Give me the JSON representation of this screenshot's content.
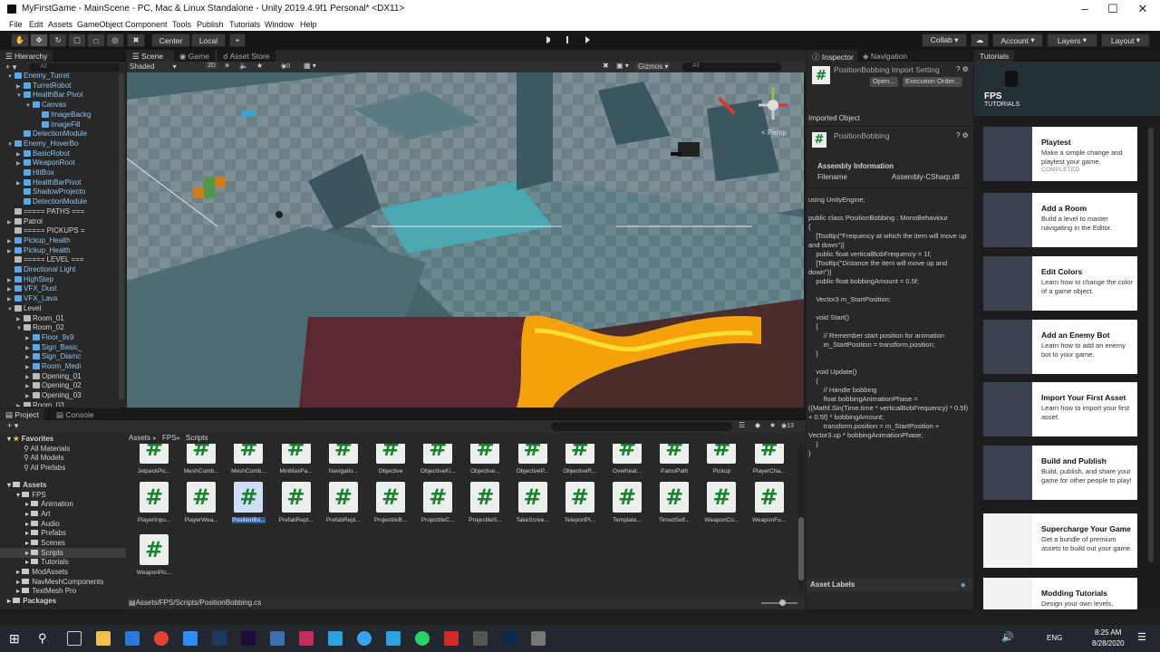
{
  "window": {
    "title": "MyFirstGame - MainScene - PC, Mac & Linux Standalone - Unity 2019.4.9f1 Personal* <DX11>"
  },
  "menu": [
    "File",
    "Edit",
    "Assets",
    "GameObject",
    "Component",
    "Tools",
    "Publish",
    "Tutorials",
    "Window",
    "Help"
  ],
  "toolbar": {
    "center": "Center",
    "local": "Local",
    "collab": "Collab ▾",
    "account": "Account",
    "layers": "Layers",
    "layout": "Layout"
  },
  "hierarchy": {
    "tab": "Hierarchy",
    "search_placeholder": "All",
    "items": [
      {
        "label": "Enemy_Turret",
        "indent": 0,
        "arrow": "▼",
        "icon": "blue"
      },
      {
        "label": "TurretRobot",
        "indent": 1,
        "arrow": "▶",
        "icon": "blue"
      },
      {
        "label": "HealthBar Pivot",
        "indent": 1,
        "arrow": "▼",
        "icon": "blue"
      },
      {
        "label": "Canvas",
        "indent": 2,
        "arrow": "▼",
        "icon": "blue"
      },
      {
        "label": "ImageBackg",
        "indent": 3,
        "arrow": "",
        "icon": "blue"
      },
      {
        "label": "ImageFill",
        "indent": 3,
        "arrow": "",
        "icon": "blue"
      },
      {
        "label": "DetectionModule",
        "indent": 1,
        "arrow": "",
        "icon": "blue"
      },
      {
        "label": "Enemy_HoverBo",
        "indent": 0,
        "arrow": "▼",
        "icon": "blue"
      },
      {
        "label": "BasicRobot",
        "indent": 1,
        "arrow": "▶",
        "icon": "blue"
      },
      {
        "label": "WeaponRoot",
        "indent": 1,
        "arrow": "▶",
        "icon": "blue"
      },
      {
        "label": "HitBox",
        "indent": 1,
        "arrow": "",
        "icon": "blue"
      },
      {
        "label": "HealthBarPivot",
        "indent": 1,
        "arrow": "▶",
        "icon": "blue"
      },
      {
        "label": "ShadowProjecto",
        "indent": 1,
        "arrow": "",
        "icon": "blue"
      },
      {
        "label": "DetectionModule",
        "indent": 1,
        "arrow": "",
        "icon": "blue"
      },
      {
        "label": "===== PATHS ===",
        "indent": 0,
        "arrow": "",
        "icon": "gray"
      },
      {
        "label": "Patrol",
        "indent": 0,
        "arrow": "▶",
        "icon": "gray"
      },
      {
        "label": "===== PICKUPS =",
        "indent": 0,
        "arrow": "",
        "icon": "gray"
      },
      {
        "label": "Pickup_Health",
        "indent": 0,
        "arrow": "▶",
        "icon": "blue"
      },
      {
        "label": "Pickup_Health",
        "indent": 0,
        "arrow": "▶",
        "icon": "blue"
      },
      {
        "label": "===== LEVEL ===",
        "indent": 0,
        "arrow": "",
        "icon": "gray"
      },
      {
        "label": "Directional Light",
        "indent": 0,
        "arrow": "",
        "icon": "blue"
      },
      {
        "label": "HighStep",
        "indent": 0,
        "arrow": "▶",
        "icon": "blue"
      },
      {
        "label": "VFX_Dust",
        "indent": 0,
        "arrow": "▶",
        "icon": "blue"
      },
      {
        "label": "VFX_Lava",
        "indent": 0,
        "arrow": "▶",
        "icon": "blue"
      },
      {
        "label": "Level",
        "indent": 0,
        "arrow": "▼",
        "icon": "gray"
      },
      {
        "label": "Room_01",
        "indent": 1,
        "arrow": "▶",
        "icon": "gray"
      },
      {
        "label": "Room_02",
        "indent": 1,
        "arrow": "▼",
        "icon": "gray"
      },
      {
        "label": "Floor_9x9",
        "indent": 2,
        "arrow": "▶",
        "icon": "blue"
      },
      {
        "label": "Sign_Basic_",
        "indent": 2,
        "arrow": "▶",
        "icon": "blue"
      },
      {
        "label": "Sign_Diamc",
        "indent": 2,
        "arrow": "▶",
        "icon": "blue"
      },
      {
        "label": "Room_Medi",
        "indent": 2,
        "arrow": "▶",
        "icon": "blue"
      },
      {
        "label": "Opening_01",
        "indent": 2,
        "arrow": "▶",
        "icon": "gray"
      },
      {
        "label": "Opening_02",
        "indent": 2,
        "arrow": "▶",
        "icon": "gray"
      },
      {
        "label": "Opening_03",
        "indent": 2,
        "arrow": "▶",
        "icon": "gray"
      },
      {
        "label": "Room_03",
        "indent": 1,
        "arrow": "▶",
        "icon": "gray"
      }
    ]
  },
  "scene": {
    "tabs": [
      "Scene",
      "Game",
      "Asset Store"
    ],
    "shading": "Shaded",
    "mode2d": "2D",
    "fx": "0",
    "gizmos": "Gizmos",
    "search_placeholder": "All",
    "persp": "< Persp"
  },
  "project": {
    "tabs": [
      "Project",
      "Console"
    ],
    "count": "13",
    "breadcrumb": [
      "Assets",
      "FPS",
      "Scripts"
    ],
    "favorites": {
      "label": "Favorites",
      "items": [
        "All Materials",
        "All Models",
        "All Prefabs"
      ]
    },
    "assets_label": "Assets",
    "tree": [
      "FPS",
      "Animation",
      "Art",
      "Audio",
      "Prefabs",
      "Scenes",
      "Scripts",
      "Tutorials",
      "ModAssets",
      "NavMeshComponents",
      "TextMesh Pro"
    ],
    "packages": "Packages",
    "row1": [
      "JetpackPic...",
      "MeshComb...",
      "MeshComb...",
      "MinMaxPa...",
      "Navigatio...",
      "Objective",
      "ObjectiveKi...",
      "Objective...",
      "ObjectiveP...",
      "ObjectiveR...",
      "Overheat...",
      "PatrolPath",
      "Pickup",
      "PlayerCha..."
    ],
    "row2": [
      "PlayerInpu...",
      "PlayerWea...",
      "PositionBo...",
      "PrefabRepl...",
      "PrefabRepl...",
      "ProjectileB...",
      "ProjectileC...",
      "ProjectileS...",
      "TakeScree...",
      "TeleportPl...",
      "Template...",
      "TimedSelf...",
      "WeaponCo...",
      "WeaponFu..."
    ],
    "row3": [
      "WeaponPic..."
    ],
    "status": "Assets/FPS/Scripts/PositionBobbing.cs"
  },
  "inspector": {
    "tabs": [
      "Inspector",
      "Navigation"
    ],
    "title": "PositionBobbing Import Setting",
    "open": "Open...",
    "exec": "Execution Order...",
    "imported": "Imported Object",
    "obj": "PositionBobbing",
    "asm": "Assembly Information",
    "fn_label": "Filename",
    "fn_value": "Assembly-CSharp.dll",
    "code": "using UnityEngine;\n\npublic class PositionBobbing : MonoBehaviour\n{\n    [Tooltip(\"Frequency at which the item will move up and down\")]\n    public float verticalBobFrequency = 1f;\n    [Tooltip(\"Distance the item will move up and down\")]\n    public float bobbingAmount = 0.5f;\n\n    Vector3 m_StartPosition;\n\n    void Start()\n    {\n        // Remember start position for animation\n        m_StartPosition = transform.position;\n    }\n\n    void Update()\n    {\n        // Handle bobbing\n        float bobbingAnimationPhase = ((Mathf.Sin(Time.time * verticalBobFrequency) * 0.5f) + 0.5f) * bobbingAmount;\n        transform.position = m_StartPosition + Vector3.up * bobbingAnimationPhase;\n    }\n}",
    "labels": "Asset Labels"
  },
  "tutorials": {
    "tab": "Tutorials",
    "header1": "FPS",
    "header2": "TUTORIALS",
    "cards": [
      {
        "title": "Playtest",
        "desc": "Make a simple change and playtest your game.",
        "status": "COMPLETED",
        "color": "#3b4350"
      },
      {
        "title": "Add a Room",
        "desc": "Build a level to master navigating in the Editor.",
        "status": "",
        "color": "#3b4350"
      },
      {
        "title": "Edit Colors",
        "desc": "Learn how to change the color of a game object.",
        "status": "",
        "color": "#3b4350"
      },
      {
        "title": "Add an Enemy Bot",
        "desc": "Learn how to add an enemy bot to your game.",
        "status": "",
        "color": "#3b4350"
      },
      {
        "title": "Import Your First Asset",
        "desc": "Learn how to import your first asset.",
        "status": "",
        "color": "#3b4350"
      },
      {
        "title": "Build and Publish",
        "desc": "Build, publish, and share your game for other people to play!",
        "status": "",
        "color": "#3b4350"
      },
      {
        "title": "Supercharge Your Game",
        "desc": "Get a bundle of premium assets to build out your game.",
        "status": "",
        "color": "#f2f2f2"
      },
      {
        "title": "Modding Tutorials",
        "desc": "Design your own levels,",
        "status": "",
        "color": "#f2f2f2"
      }
    ]
  },
  "taskbar": {
    "time": "8:25 AM",
    "date": "8/28/2020",
    "lang": "ENG"
  }
}
